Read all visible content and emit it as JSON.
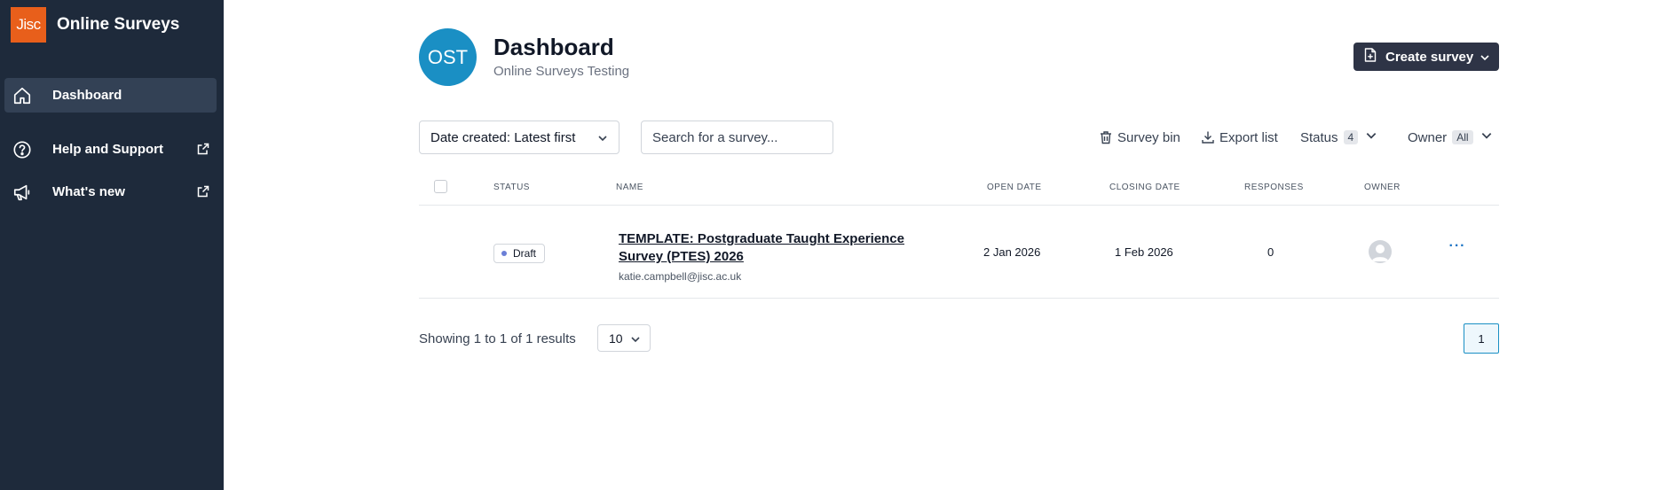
{
  "app": {
    "logo_text": "Jisc",
    "title": "Online Surveys"
  },
  "sidebar": {
    "items": [
      {
        "label": "Dashboard",
        "icon": "home-icon",
        "active": true
      },
      {
        "label": "Help and Support",
        "icon": "help-circle-icon",
        "external": true
      },
      {
        "label": "What's new",
        "icon": "megaphone-icon",
        "external": true
      }
    ]
  },
  "header": {
    "avatar_initials": "OST",
    "title": "Dashboard",
    "subtitle": "Online Surveys Testing",
    "create_button": "Create survey"
  },
  "filters": {
    "sort_value": "Date created: Latest first",
    "search_placeholder": "Search for a survey...",
    "survey_bin": "Survey bin",
    "export_list": "Export list",
    "status_label": "Status",
    "status_count": "4",
    "owner_label": "Owner",
    "owner_value": "All"
  },
  "table": {
    "columns": [
      "Status",
      "Name",
      "Open date",
      "Closing date",
      "Responses",
      "Owner"
    ],
    "rows": [
      {
        "status": "Draft",
        "name": "TEMPLATE: Postgraduate Taught Experience Survey (PTES) 2026",
        "owner_email": "katie.campbell@jisc.ac.uk",
        "open_date": "2 Jan 2026",
        "closing_date": "1 Feb 2026",
        "responses": "0",
        "more": "···"
      }
    ]
  },
  "footer": {
    "results_text": "Showing 1 to 1 of 1 results",
    "page_size": "10",
    "current_page": "1"
  },
  "colors": {
    "sidebar_bg": "#1e2a3b",
    "brand_orange": "#e85f1b",
    "avatar_blue": "#1a8fc4",
    "button_dark": "#2e3446"
  }
}
